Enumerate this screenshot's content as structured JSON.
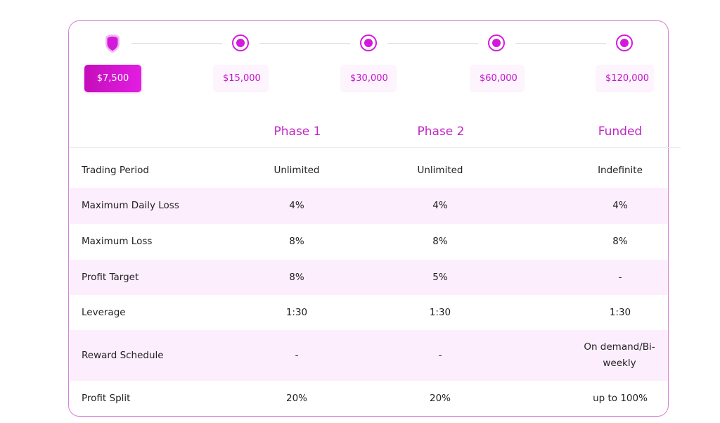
{
  "stepper": {
    "amounts": [
      {
        "label": "$7,500",
        "active": true
      },
      {
        "label": "$15,000",
        "active": false
      },
      {
        "label": "$30,000",
        "active": false
      },
      {
        "label": "$60,000",
        "active": false
      },
      {
        "label": "$120,000",
        "active": false
      }
    ]
  },
  "table": {
    "headers": [
      "Phase 1",
      "Phase 2",
      "Funded"
    ],
    "rows": [
      {
        "label": "Trading Period",
        "phase1": "Unlimited",
        "phase2": "Unlimited",
        "funded": "Indefinite"
      },
      {
        "label": "Maximum Daily Loss",
        "phase1": "4%",
        "phase2": "4%",
        "funded": "4%"
      },
      {
        "label": "Maximum Loss",
        "phase1": "8%",
        "phase2": "8%",
        "funded": "8%"
      },
      {
        "label": "Profit Target",
        "phase1": "8%",
        "phase2": "5%",
        "funded": "-"
      },
      {
        "label": "Leverage",
        "phase1": "1:30",
        "phase2": "1:30",
        "funded": "1:30"
      },
      {
        "label": "Reward Schedule",
        "phase1": "-",
        "phase2": "-",
        "funded": "On demand/Bi-weekly"
      },
      {
        "label": "Profit Split",
        "phase1": "20%",
        "phase2": "20%",
        "funded": "up to 100%"
      }
    ]
  },
  "colors": {
    "accent": "#d21bd8",
    "header_text": "#c126c5",
    "row_shade": "#fdeefe",
    "card_border": "#d680d9"
  }
}
